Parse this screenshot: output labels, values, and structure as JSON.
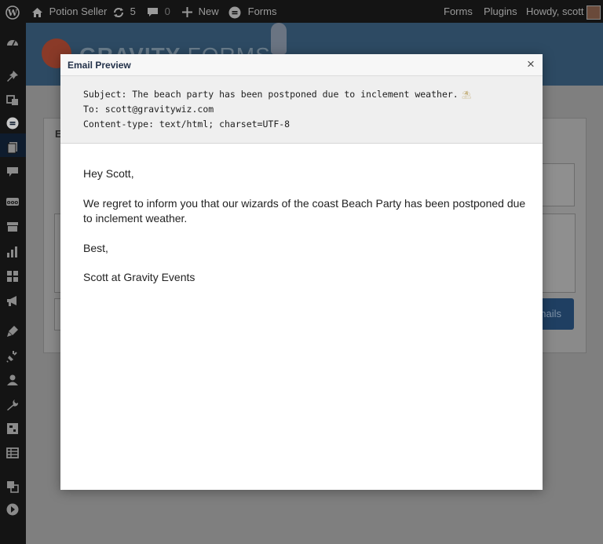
{
  "admin_bar": {
    "site_name": "Potion Seller",
    "updates_count": "5",
    "comments_count": "0",
    "new_label": "New",
    "forms_label": "Forms",
    "right_forms": "Forms",
    "right_plugins": "Plugins",
    "howdy": "Howdy, scott"
  },
  "background": {
    "logo_text_bold": "GRAVITY",
    "logo_text_light": "FORMS",
    "panel_letter": "E",
    "send_button_fragment": "nails"
  },
  "modal": {
    "title": "Email Preview",
    "close_glyph": "×",
    "subject": "Subject: The beach party has been postponed due to inclement weather.",
    "subject_emoji": "⛱",
    "to": "To: scott@gravitywiz.com",
    "content_type": "Content-type: text/html; charset=UTF-8",
    "greeting": "Hey Scott,",
    "paragraph": "We regret to inform you that our wizards of the coast Beach Party has been postponed due to inclement weather.",
    "closing": "Best,",
    "signature": "Scott at Gravity Events"
  },
  "colors": {
    "admin_bar_bg": "#141414",
    "header_bg": "#2d4a63",
    "modal_title": "#23324a",
    "brand_orange": "#8a3a28"
  },
  "icons": {
    "admin_bar": [
      "wordpress-logo-icon",
      "home-icon",
      "updates-icon",
      "comments-icon",
      "plus-icon",
      "gravity-forms-icon",
      "avatar"
    ],
    "sidebar": [
      "dashboard-icon",
      "pin-icon",
      "media-icon",
      "forms-icon",
      "pages-icon",
      "comments-icon",
      "woo-icon",
      "archive-icon",
      "analytics-icon",
      "blocks-icon",
      "megaphone-icon",
      "appearance-icon",
      "plugins-icon",
      "users-icon",
      "tools-icon",
      "settings-icon",
      "table-icon",
      "translate-icon",
      "collapse-icon"
    ]
  }
}
